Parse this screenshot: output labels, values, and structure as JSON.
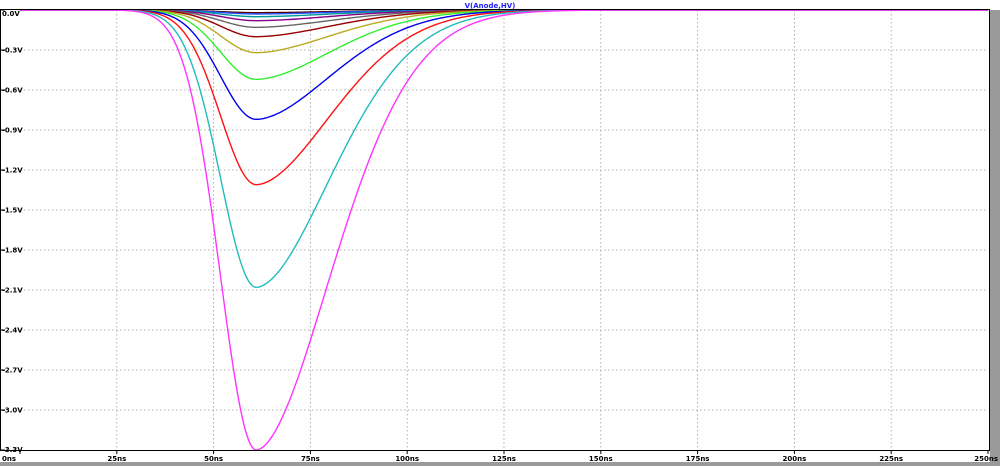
{
  "chart_data": {
    "type": "line",
    "title": "V(Anode,HV)",
    "xlabel": "",
    "ylabel": "",
    "xlim": [
      0,
      250
    ],
    "ylim": [
      -3.3,
      0.0
    ],
    "x_ticks": [
      0,
      25,
      50,
      75,
      100,
      125,
      150,
      175,
      200,
      225,
      250
    ],
    "x_tick_labels": [
      "0ns",
      "25ns",
      "50ns",
      "75ns",
      "100ns",
      "125ns",
      "150ns",
      "175ns",
      "200ns",
      "225ns",
      "250ns"
    ],
    "y_ticks": [
      0.0,
      -0.3,
      -0.6,
      -0.9,
      -1.2,
      -1.5,
      -1.8,
      -2.1,
      -2.4,
      -2.7,
      -3.0,
      -3.3
    ],
    "y_tick_labels": [
      "0.0V",
      "-0.3V",
      "-0.6V",
      "-0.9V",
      "-1.2V",
      "-1.5V",
      "-1.8V",
      "-2.1V",
      "-2.4V",
      "-2.7V",
      "-3.0V",
      "-3.3V"
    ],
    "grid": true,
    "legend": "none",
    "pulse": {
      "start_ns": 21,
      "peak_ns": 61,
      "rise_width_ns": 13,
      "fall_width_ns": 28,
      "fall_sharpness": 1.8
    },
    "series": [
      {
        "color": "#ff33ff",
        "peak_value": -3.3
      },
      {
        "color": "#22bbbb",
        "peak_value": -2.08
      },
      {
        "color": "#ff1111",
        "peak_value": -1.31
      },
      {
        "color": "#0000ee",
        "peak_value": -0.82
      },
      {
        "color": "#33ee33",
        "peak_value": -0.52
      },
      {
        "color": "#bbaa22",
        "peak_value": -0.32
      },
      {
        "color": "#990000",
        "peak_value": -0.2
      },
      {
        "color": "#666666",
        "peak_value": -0.13
      },
      {
        "color": "#880088",
        "peak_value": -0.08
      },
      {
        "color": "#009999",
        "peak_value": -0.05
      },
      {
        "color": "#2255ff",
        "peak_value": -0.03
      },
      {
        "color": "#550000",
        "peak_value": -0.02
      }
    ]
  }
}
